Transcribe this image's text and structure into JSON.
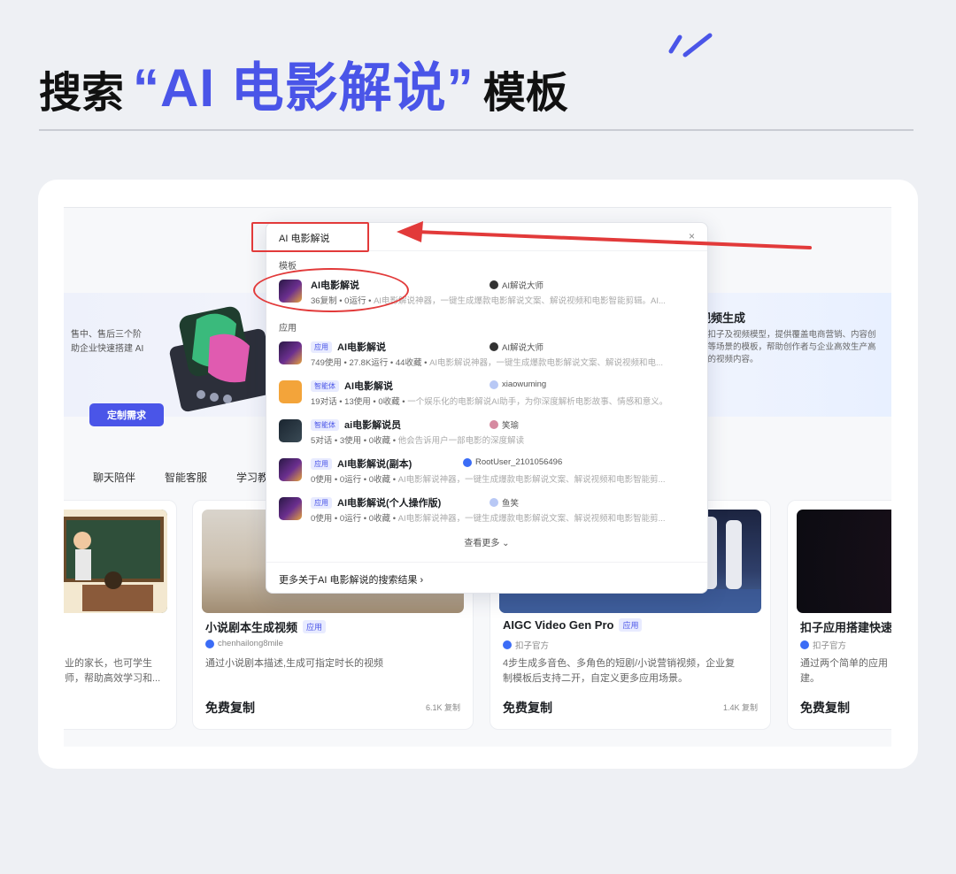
{
  "headline": {
    "prefix": "搜索",
    "keyword": "“AI 电影解说”",
    "suffix": "模板"
  },
  "colors": {
    "accent": "#4a55e8",
    "highlight_red": "#e23a3a"
  },
  "banner": {
    "left_text_line1": "售中、售后三个阶",
    "left_text_line2": "助企业快速搭建 AI",
    "right_title": "视频生成",
    "right_desc_line1": "于扣子及视频模型，提供覆盖电商营销、内容创",
    "right_desc_line2": "要等场景的模板，帮助创作者与企业高效生产高",
    "right_desc_line3": "化的视频内容。"
  },
  "category_tabs": [
    "聊天陪伴",
    "智能客服",
    "学习教育"
  ],
  "search": {
    "query": "AI 电影解说",
    "clear_icon": "close-icon",
    "section_templates": "模板",
    "section_apps": "应用",
    "view_more": "查看更多 ⌄",
    "more_results": "更多关于AI 电影解说的搜索结果 ›",
    "results": [
      {
        "tag": "",
        "name": "AI电影解说",
        "author": "AI解说大师",
        "meta": "36复制 • 0运行 • ",
        "desc": "AI电影解说神器，一键生成爆款电影解说文案、解说视频和电影智能剪辑。AI..."
      },
      {
        "tag": "应用",
        "name": "AI电影解说",
        "author": "AI解说大师",
        "meta": "749使用 • 27.8K运行 • 44收藏 • ",
        "desc": "AI电影解说神器，一键生成爆款电影解说文案、解说视频和电..."
      },
      {
        "tag": "智能体",
        "name": "AI电影解说",
        "author": "xiaowuming",
        "meta": "19对话 • 13使用 • 0收藏 • ",
        "desc": "一个娱乐化的电影解说AI助手，为你深度解析电影故事、情感和意义。"
      },
      {
        "tag": "智能体",
        "name": "ai电影解说员",
        "author": "笑瑜",
        "meta": "5对话 • 3使用 • 0收藏 • ",
        "desc": "他会告诉用户一部电影的深度解读"
      },
      {
        "tag": "应用",
        "name": "AI电影解说(副本)",
        "author": "RootUser_2101056496",
        "meta": "0使用 • 0运行 • 0收藏 • ",
        "desc": "AI电影解说神器，一键生成爆款电影解说文案、解说视频和电影智能剪..."
      },
      {
        "tag": "应用",
        "name": "AI电影解说(个人操作版)",
        "author": "鱼笑",
        "meta": "0使用 • 0运行 • 0收藏 • ",
        "desc": "AI电影解说神器，一键生成爆款电影解说文案、解说视频和电影智能剪..."
      }
    ]
  },
  "cards": [
    {
      "title": "",
      "badge": "",
      "author": "",
      "desc_line1": "业的家长，也可学生",
      "desc_line2": "师，帮助高效学习和...",
      "price": "",
      "count": "",
      "button": "定制需求"
    },
    {
      "title": "小说剧本生成视频",
      "badge": "应用",
      "author": "chenhailong8mile",
      "desc_line1": "通过小说剧本描述,生成可指定时长的视频",
      "desc_line2": "",
      "price": "免费复制",
      "count": "6.1K 复制"
    },
    {
      "title": "AIGC Video Gen Pro",
      "badge": "应用",
      "author": "扣子官方",
      "desc_line1": "4步生成多音色、多角色的短剧/小说营销视频，企业复",
      "desc_line2": "制模板后支持二开，自定义更多应用场景。",
      "price": "免费复制",
      "count": "1.4K 复制"
    },
    {
      "title": "扣子应用搭建快速",
      "badge": "",
      "author": "扣子官方",
      "desc_line1": "通过两个简单的应用",
      "desc_line2": "建。",
      "price": "免费复制",
      "count": ""
    }
  ]
}
